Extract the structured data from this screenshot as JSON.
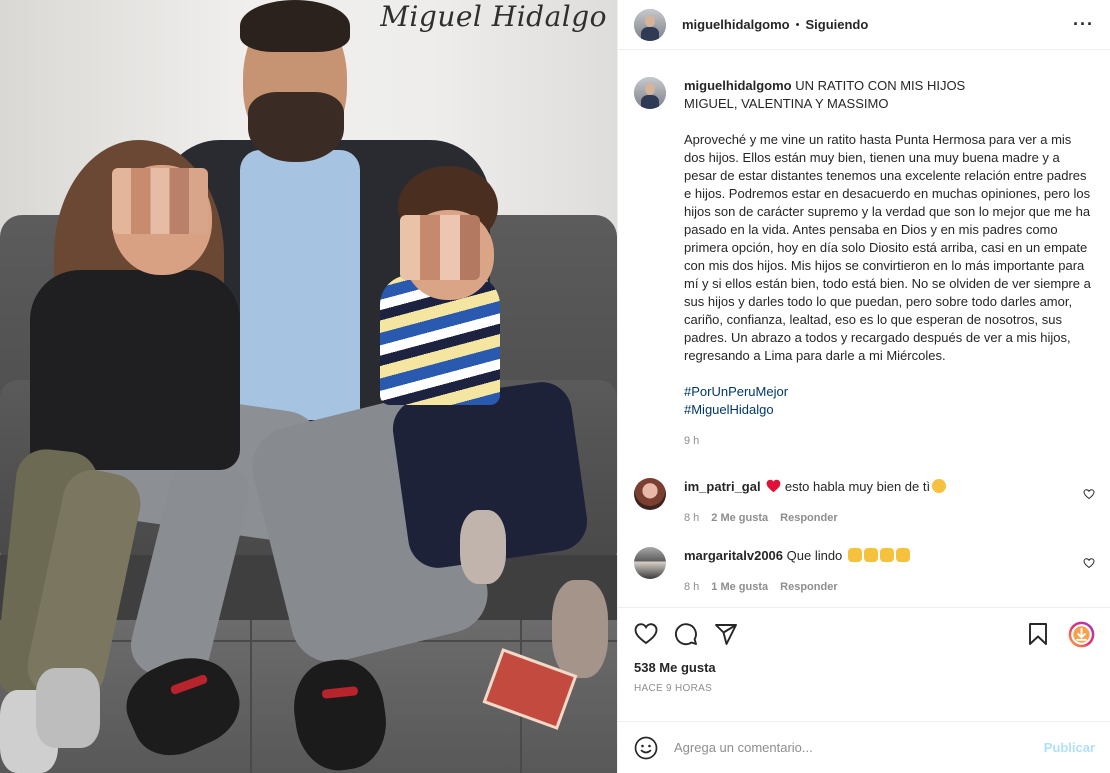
{
  "photo": {
    "watermark": "Miguel Hidalgo"
  },
  "header": {
    "username": "miguelhidalgomo",
    "separator": "•",
    "follow_status": "Siguiendo",
    "more_icon": "more-horizontal-icon"
  },
  "caption": {
    "username": "miguelhidalgomo",
    "title": "UN RATITO CON MIS HIJOS\nMIGUEL, VALENTINA Y MASSIMO",
    "body": "Aproveché y me vine un ratito hasta Punta Hermosa para ver a mis dos hijos. Ellos están muy bien, tienen una muy buena madre y a pesar de estar distantes tenemos una excelente relación entre padres e hijos. Podremos estar en desacuerdo en muchas opiniones, pero los hijos son de carácter supremo y la verdad que son lo mejor que me ha pasado en la vida. Antes pensaba en Dios y en mis padres como primera opción, hoy en día solo Diosito está arriba, casi en un empate con mis dos hijos. Mis hijos se convirtieron en lo más importante para mí y si ellos están bien, todo está bien. No se olviden de ver siempre a sus hijos y darles todo lo que puedan, pero sobre todo darles amor, cariño, confianza, lealtad, eso es lo que esperan de nosotros, sus padres. Un abrazo a todos y recargado después de ver a mis hijos, regresando a Lima para darle a mi Miércoles.",
    "hashtags": [
      "#PorUnPeruMejor",
      "#MiguelHidalgo"
    ],
    "time": "9 h"
  },
  "comments": [
    {
      "username": "im_patri_gal",
      "text": "esto habla muy bien de tì",
      "emojis": [
        "red-heart",
        "clapping-hands"
      ],
      "time": "8 h",
      "likes": "2 Me gusta",
      "reply": "Responder"
    },
    {
      "username": "margaritalv2006",
      "text": "Que lindo",
      "emojis": [
        "raising-hands",
        "raising-hands",
        "raising-hands",
        "raising-hands"
      ],
      "time": "8 h",
      "likes": "1 Me gusta",
      "reply": "Responder"
    }
  ],
  "actions": {
    "likes": "538 Me gusta",
    "posted_ago": "HACE 9 HORAS"
  },
  "composer": {
    "placeholder": "Agrega un comentario...",
    "publish_label": "Publicar"
  },
  "colors": {
    "text": "#262626",
    "muted": "#8e8e8e",
    "link": "#00376b",
    "publish_disabled": "#b2dffc",
    "heart": "#ed4956"
  }
}
